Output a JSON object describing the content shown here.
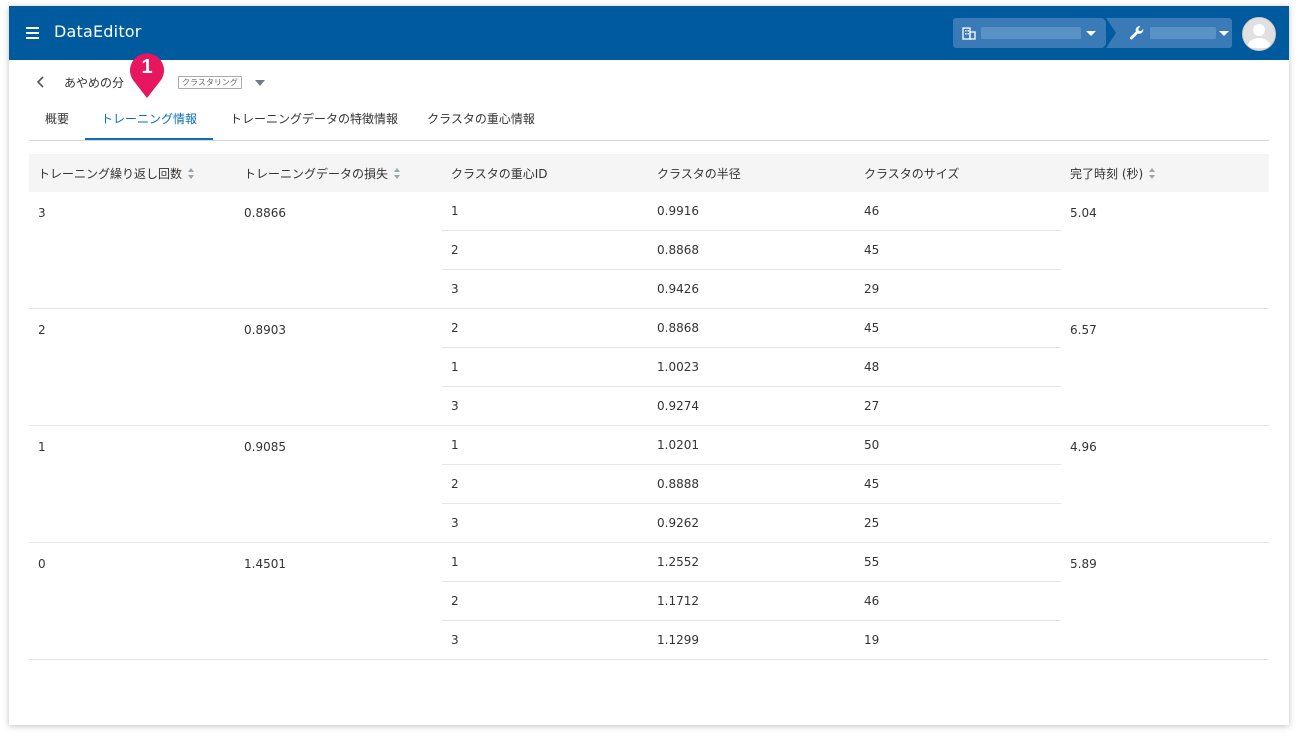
{
  "app": {
    "title": "DataEditor"
  },
  "header": {
    "org_icon": "building-icon",
    "project_icon": "wrench-icon",
    "avatar_icon": "user-avatar-icon"
  },
  "page": {
    "model_name": "あやめの分",
    "model_type": "クラスタリング"
  },
  "tabs": [
    {
      "label": "概要"
    },
    {
      "label": "トレーニング情報",
      "active": true
    },
    {
      "label": "トレーニングデータの特徴情報"
    },
    {
      "label": "クラスタの重心情報"
    }
  ],
  "marker": {
    "label": "1",
    "color": "#e8155f"
  },
  "table": {
    "headers": [
      "トレーニング繰り返し回数",
      "トレーニングデータの損失",
      "クラスタの重心ID",
      "クラスタの半径",
      "クラスタのサイズ",
      "完了時刻 (秒)"
    ],
    "groups": [
      {
        "iteration": "3",
        "loss": "0.8866",
        "time": "5.04",
        "rows": [
          {
            "id": "1",
            "radius": "0.9916",
            "size": "46"
          },
          {
            "id": "2",
            "radius": "0.8868",
            "size": "45"
          },
          {
            "id": "3",
            "radius": "0.9426",
            "size": "29"
          }
        ]
      },
      {
        "iteration": "2",
        "loss": "0.8903",
        "time": "6.57",
        "rows": [
          {
            "id": "2",
            "radius": "0.8868",
            "size": "45"
          },
          {
            "id": "1",
            "radius": "1.0023",
            "size": "48"
          },
          {
            "id": "3",
            "radius": "0.9274",
            "size": "27"
          }
        ]
      },
      {
        "iteration": "1",
        "loss": "0.9085",
        "time": "4.96",
        "rows": [
          {
            "id": "1",
            "radius": "1.0201",
            "size": "50"
          },
          {
            "id": "2",
            "radius": "0.8888",
            "size": "45"
          },
          {
            "id": "3",
            "radius": "0.9262",
            "size": "25"
          }
        ]
      },
      {
        "iteration": "0",
        "loss": "1.4501",
        "time": "5.89",
        "rows": [
          {
            "id": "1",
            "radius": "1.2552",
            "size": "55"
          },
          {
            "id": "2",
            "radius": "1.1712",
            "size": "46"
          },
          {
            "id": "3",
            "radius": "1.1299",
            "size": "19"
          }
        ]
      }
    ]
  }
}
